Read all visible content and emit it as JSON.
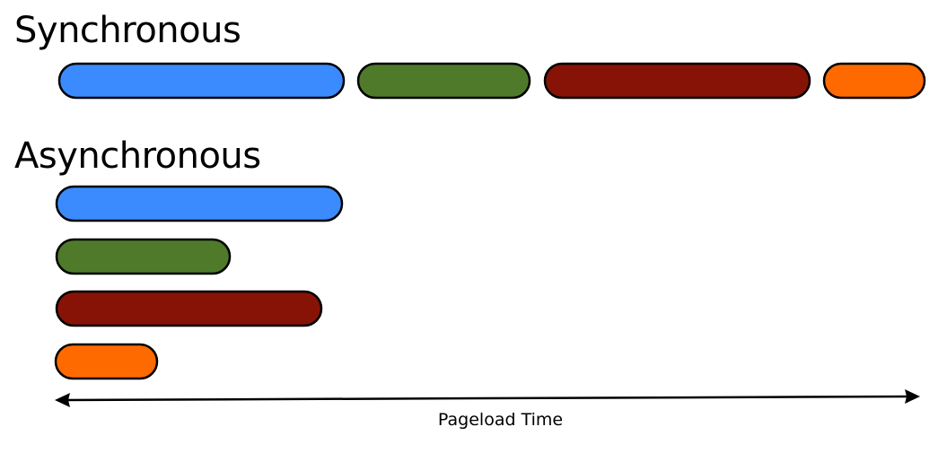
{
  "sections": {
    "sync": {
      "title": "Synchronous"
    },
    "async": {
      "title": "Asynchronous"
    }
  },
  "colors": {
    "blue": "#3b8bff",
    "green": "#4e7a2a",
    "red": "#861306",
    "orange": "#ff6a00"
  },
  "resources": [
    "blue",
    "green",
    "red",
    "orange"
  ],
  "axis": {
    "label": "Pageload Time",
    "arrow": "double-headed"
  }
}
